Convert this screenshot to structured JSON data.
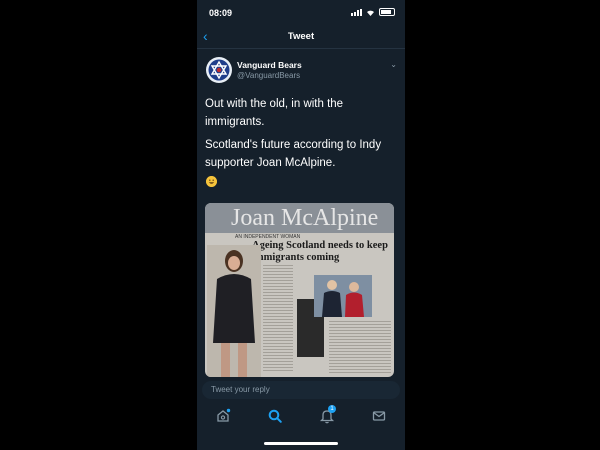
{
  "status_bar": {
    "time": "08:09"
  },
  "nav": {
    "title": "Tweet"
  },
  "tweet": {
    "display_name": "Vanguard Bears",
    "handle": "@VanguardBears",
    "paragraphs": [
      "Out with the old, in with the immigrants.",
      "Scotland's future according to Indy supporter Joan McAlpine."
    ],
    "emoji": "grinning-face"
  },
  "photo": {
    "name": "Joan McAlpine",
    "kicker": "AN INDEPENDENT WOMAN",
    "headline": "Ageing Scotland needs to keep immigrants coming"
  },
  "reply": {
    "placeholder": "Tweet your reply"
  },
  "tabbar": {
    "notifications_count": "1"
  },
  "colors": {
    "background": "#15202b",
    "accent": "#1da1f2",
    "muted": "#8899a6"
  }
}
